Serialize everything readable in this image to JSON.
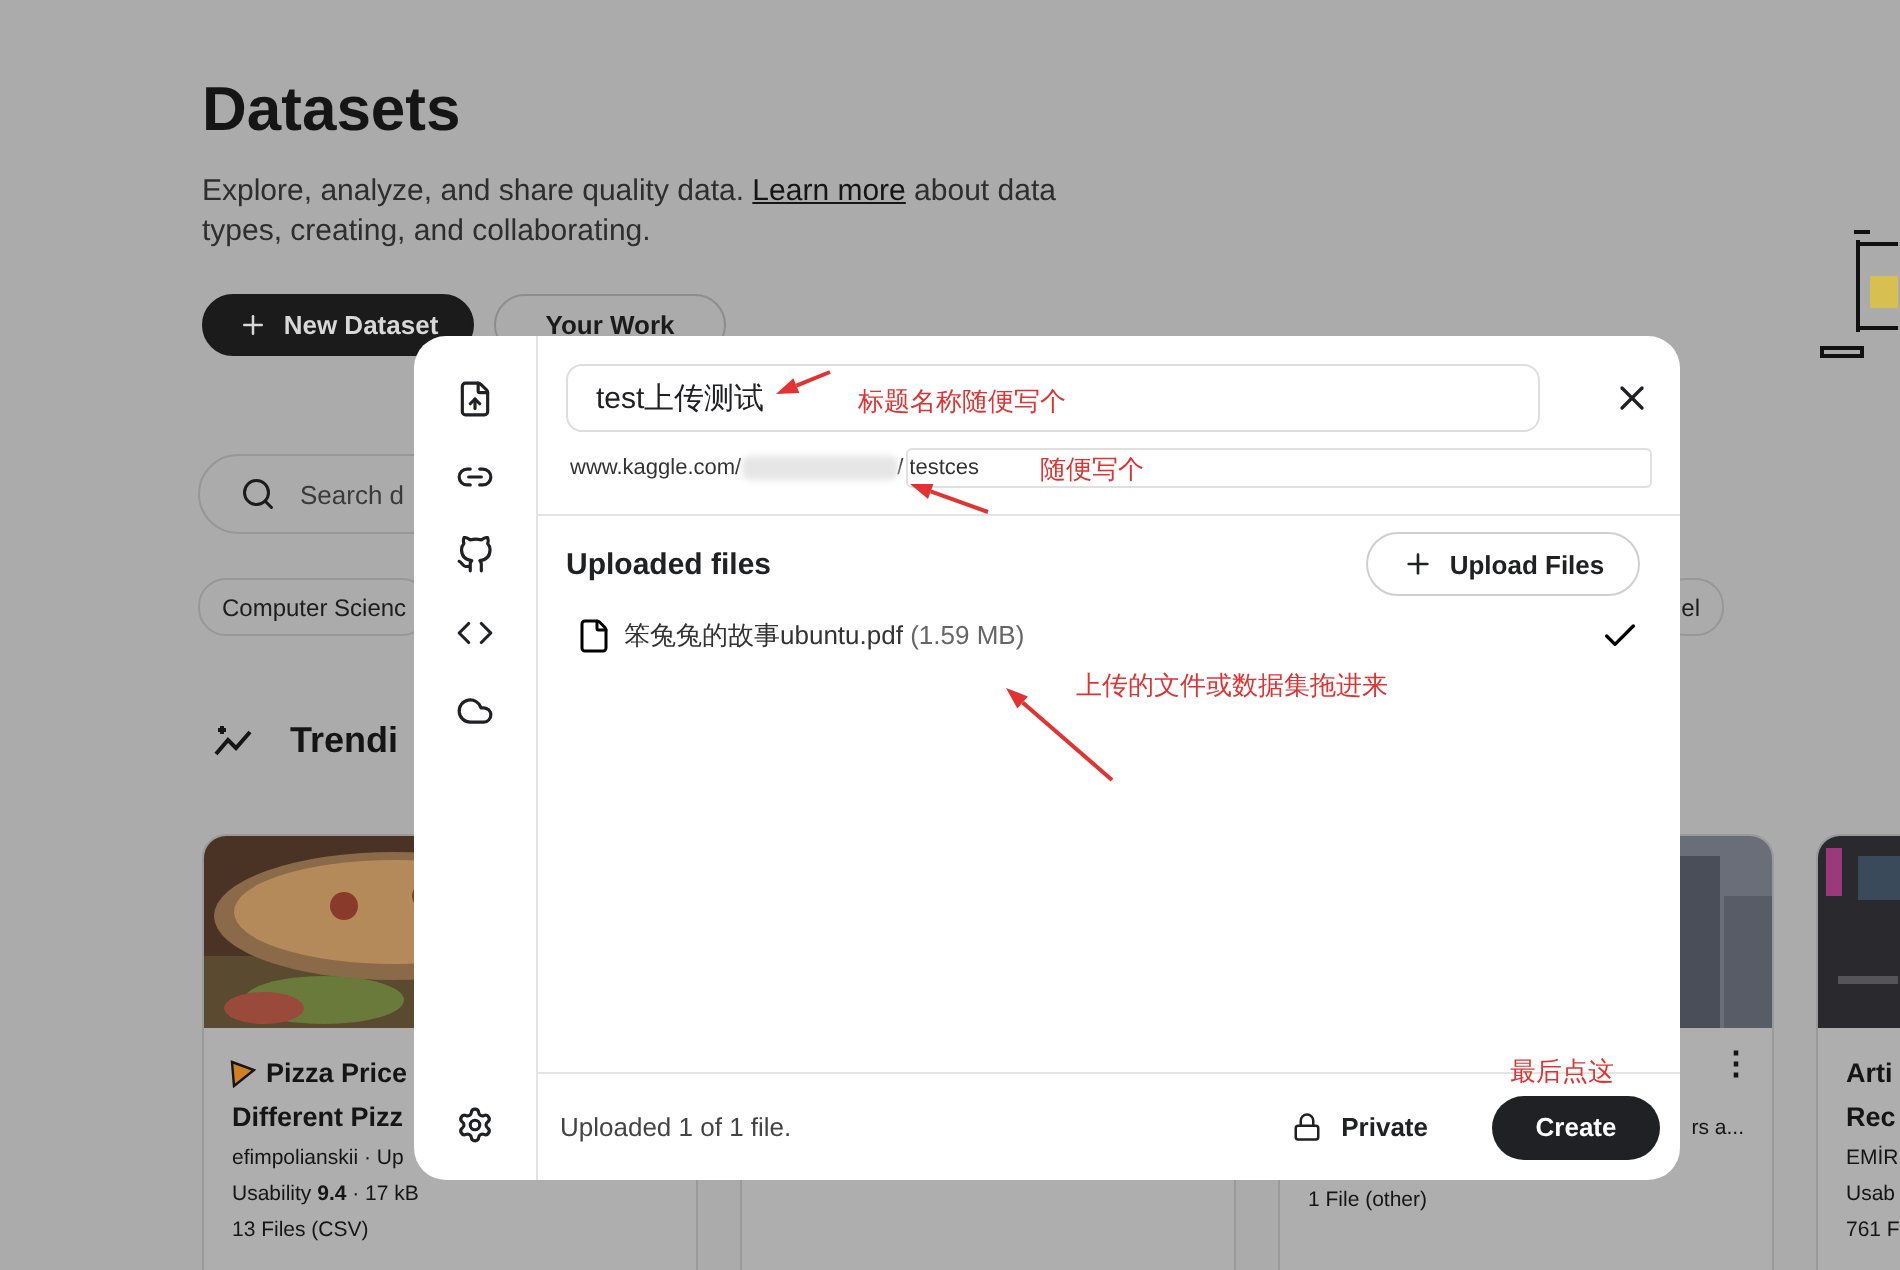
{
  "page": {
    "title": "Datasets",
    "description": [
      {
        "kind": "text",
        "text": "Explore, analyze, and share quality data. "
      },
      {
        "kind": "link",
        "text": "Learn more"
      },
      {
        "kind": "text",
        "text": " about data types, creating, and collaborating."
      }
    ],
    "buttons": [
      {
        "kind": "primary",
        "label": "New Dataset"
      },
      {
        "kind": "secondary",
        "label": "Your Work"
      }
    ],
    "search": {
      "placeholder": "Search d"
    },
    "chips": [
      "Computer Scienc",
      "el"
    ],
    "section_title": "Trendi",
    "cards": [
      {
        "kind": "picture",
        "lines": [
          {
            "kind": "title-icon",
            "text": "Pizza Price"
          },
          {
            "kind": "title",
            "text": "Different Pizz"
          },
          {
            "kind": "meta",
            "text": "efimpolianskii · Up"
          },
          {
            "kind": "meta",
            "text": "Usability **9.4** · 17 kB"
          },
          {
            "kind": "meta",
            "text": "13 Files (CSV)"
          }
        ]
      },
      {
        "kind": "blank"
      },
      {
        "kind": "picture",
        "menu": "⋮",
        "lines": [
          {
            "kind": "meta-right",
            "text": "rs a..."
          },
          {
            "kind": "meta",
            "text": "1 File (other)"
          }
        ]
      },
      {
        "kind": "picture",
        "lines": [
          {
            "kind": "title",
            "text": "Arti"
          },
          {
            "kind": "title",
            "text": "Rec"
          },
          {
            "kind": "meta",
            "text": "EMİR"
          },
          {
            "kind": "meta",
            "text": "Usab"
          },
          {
            "kind": "meta",
            "text": "761 F"
          }
        ]
      }
    ]
  },
  "modal": {
    "title_value": "test上传测试",
    "url_prefix": "www.kaggle.com/",
    "url_separator": "/",
    "slug_value": "testces",
    "section_title": "Uploaded files",
    "upload_button": "Upload Files",
    "files": [
      {
        "name": "笨兔兔的故事ubuntu.pdf",
        "size": "(1.59 MB)",
        "done": true
      }
    ],
    "status": "Uploaded 1 of 1 file.",
    "privacy": "Private",
    "create": "Create"
  },
  "annotations": [
    "标题名称随便写个",
    "随便写个",
    "上传的文件或数据集拖进来",
    "最后点这"
  ]
}
